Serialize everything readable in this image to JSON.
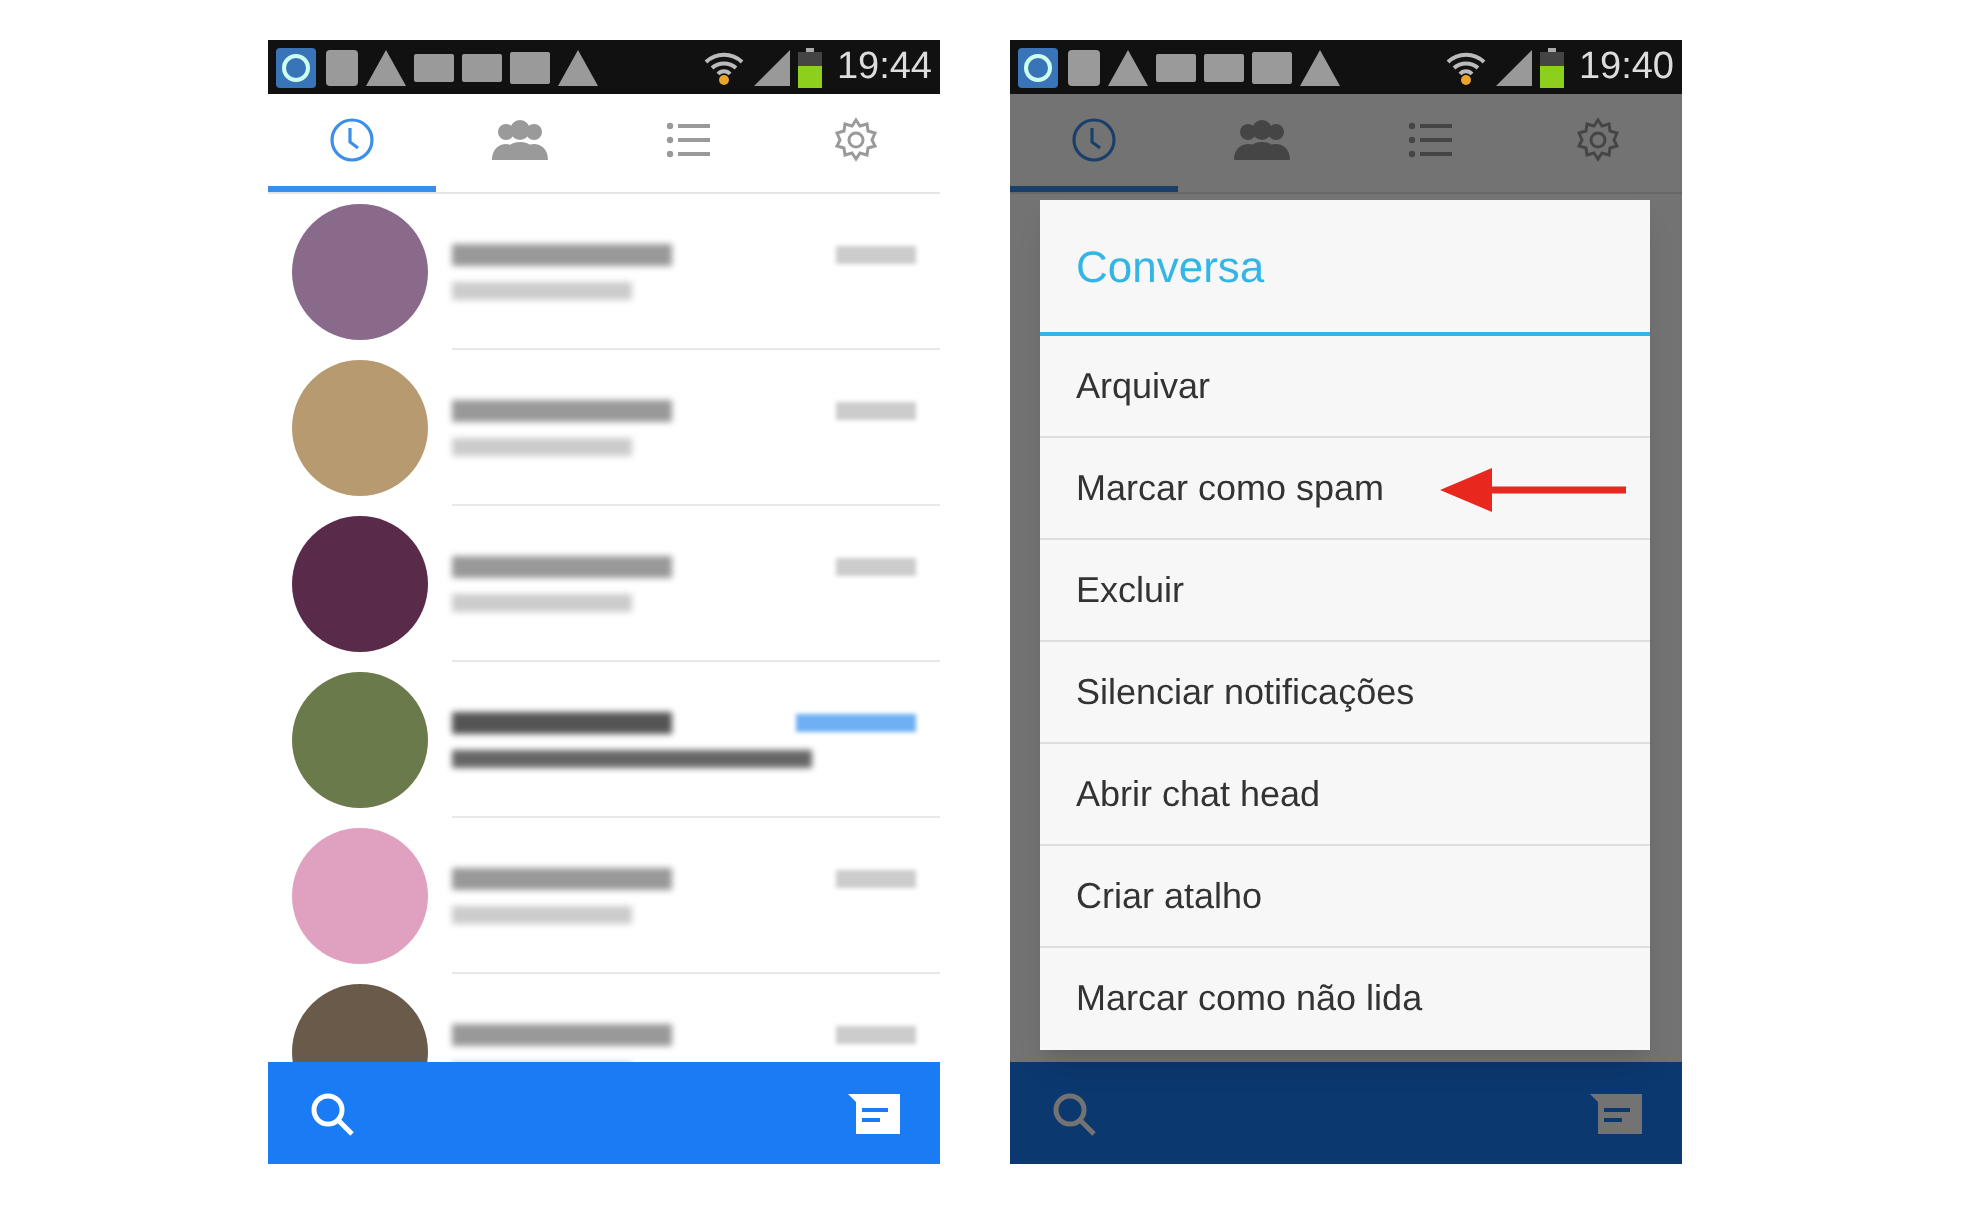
{
  "phones": [
    {
      "status_time": "19:44",
      "tabs": [
        {
          "kind": "recent",
          "selected": true
        },
        {
          "kind": "groups",
          "selected": false
        },
        {
          "kind": "list",
          "selected": false
        },
        {
          "kind": "settings",
          "selected": false
        }
      ],
      "conversations": [
        {
          "unread": false
        },
        {
          "unread": false
        },
        {
          "unread": false
        },
        {
          "unread": true
        },
        {
          "unread": false
        },
        {
          "unread": false
        }
      ]
    },
    {
      "status_time": "19:40",
      "tabs": [
        {
          "kind": "recent",
          "selected": true
        },
        {
          "kind": "groups",
          "selected": false
        },
        {
          "kind": "list",
          "selected": false
        },
        {
          "kind": "settings",
          "selected": false
        }
      ],
      "dialog": {
        "title": "Conversa",
        "items": [
          {
            "label": "Arquivar",
            "pointed": false
          },
          {
            "label": "Marcar como spam",
            "pointed": true
          },
          {
            "label": "Excluir",
            "pointed": false
          },
          {
            "label": "Silenciar notificações",
            "pointed": false
          },
          {
            "label": "Abrir chat head",
            "pointed": false
          },
          {
            "label": "Criar atalho",
            "pointed": false
          },
          {
            "label": "Marcar como não lida",
            "pointed": false
          }
        ]
      }
    }
  ]
}
